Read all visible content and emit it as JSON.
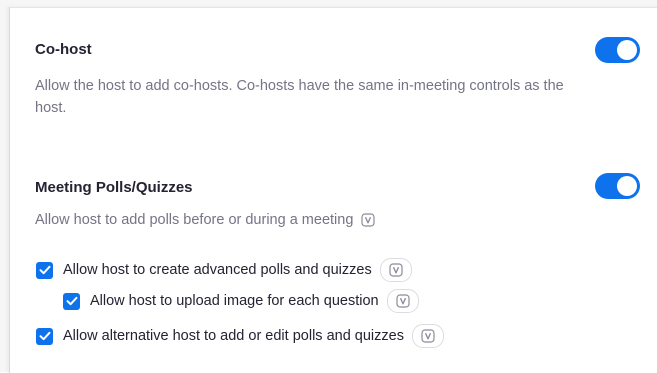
{
  "cohost": {
    "title": "Co-host",
    "description": "Allow the host to add co-hosts. Co-hosts have the same in-meeting controls as the host.",
    "enabled": true
  },
  "polls": {
    "title": "Meeting Polls/Quizzes",
    "description": "Allow host to add polls before or during a meeting",
    "enabled": true,
    "options": [
      {
        "label": "Allow host to create advanced polls and quizzes",
        "checked": true
      },
      {
        "label": "Allow host to upload image for each question",
        "checked": true
      },
      {
        "label": "Allow alternative host to add or edit polls and quizzes",
        "checked": true
      }
    ]
  },
  "icons": {
    "info_badge": "verified-info-icon",
    "check": "checkmark-icon"
  },
  "colors": {
    "accent": "#0e72ed",
    "title": "#232333",
    "description": "#747487"
  }
}
